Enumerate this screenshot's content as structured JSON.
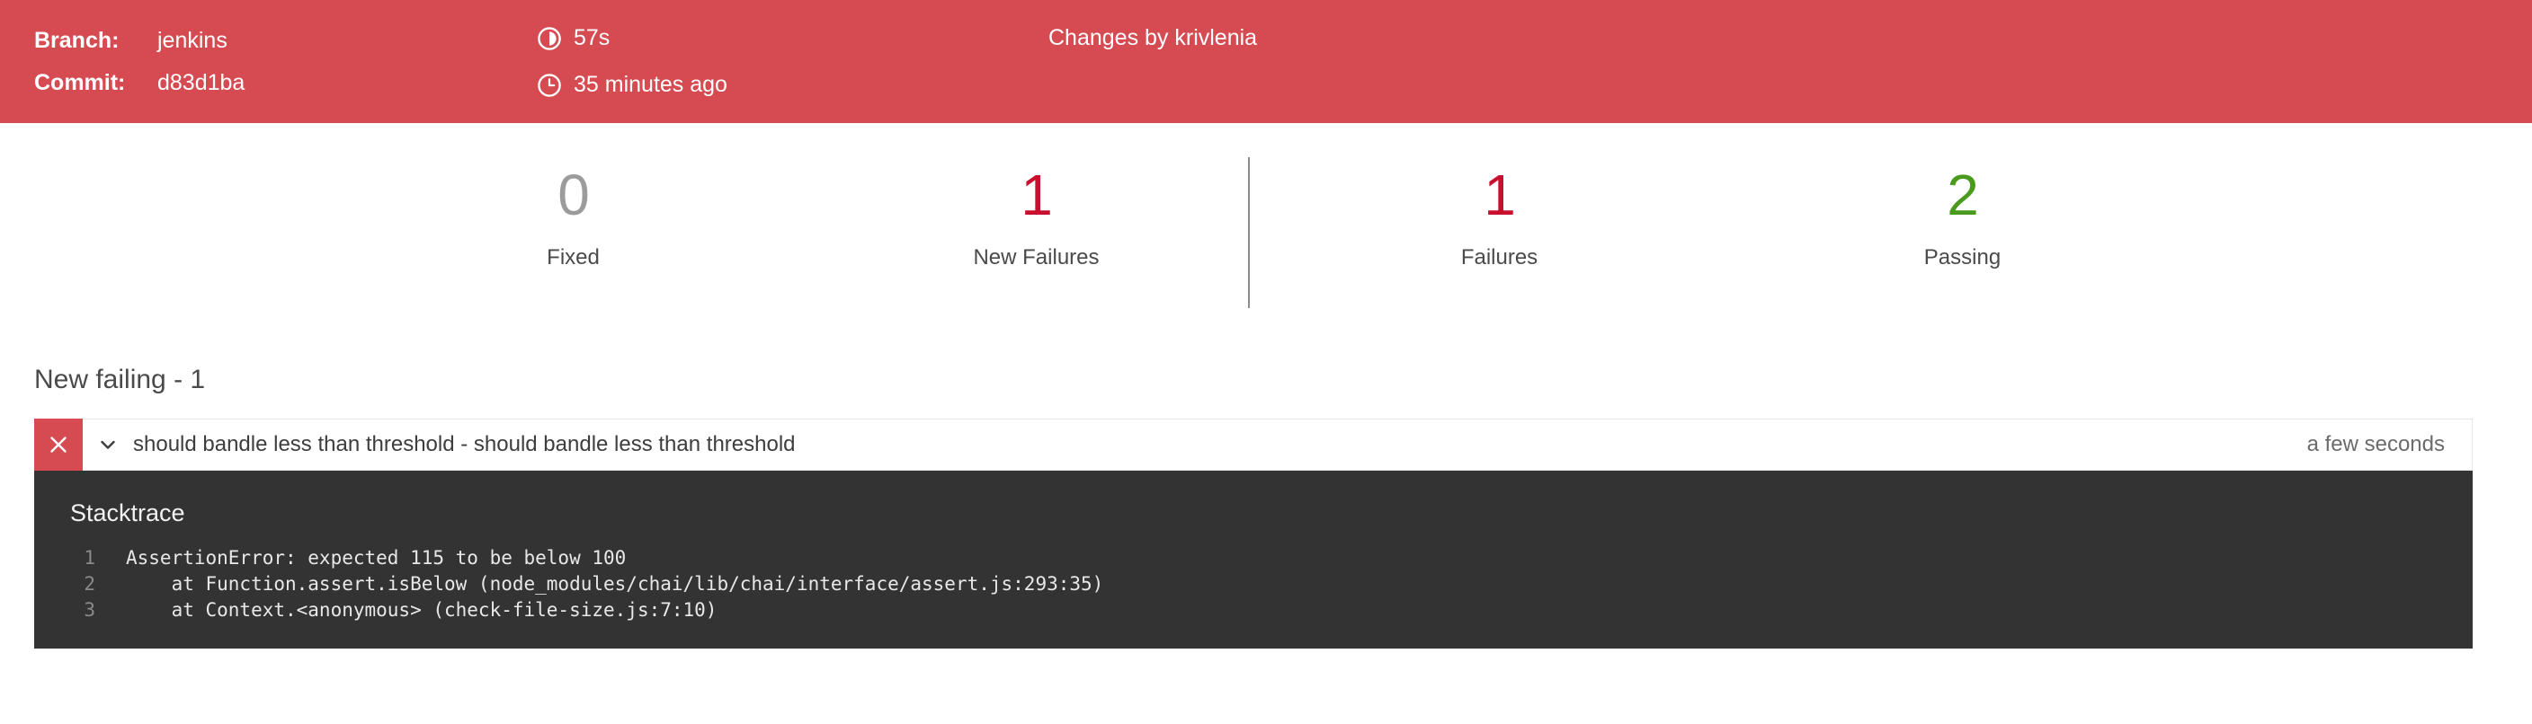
{
  "header": {
    "background_color": "#d54b51",
    "branch_label": "Branch:",
    "branch_value": "jenkins",
    "commit_label": "Commit:",
    "commit_value": "d83d1ba",
    "duration_icon": "duration-pie-icon",
    "duration_value": "57s",
    "time_icon": "clock-icon",
    "time_value": "35 minutes ago",
    "changes_by": "Changes by krivlenia"
  },
  "stats": {
    "items": [
      {
        "value": "0",
        "label": "Fixed",
        "color": "#9b9b9b",
        "tone": "grey"
      },
      {
        "value": "1",
        "label": "New Failures",
        "color": "#c8102e",
        "tone": "red"
      },
      {
        "value": "1",
        "label": "Failures",
        "color": "#c8102e",
        "tone": "red"
      },
      {
        "value": "2",
        "label": "Passing",
        "color": "#4a9a1e",
        "tone": "green"
      }
    ]
  },
  "section": {
    "heading": "New failing - 1"
  },
  "result": {
    "status_icon": "close-x-icon",
    "status_color": "#d54b51",
    "expander_icon": "chevron-down-icon",
    "title": "should bandle less than threshold - should bandle less than threshold",
    "duration": "a few seconds",
    "stacktrace_title": "Stacktrace",
    "stacktrace_lines": [
      {
        "n": "1",
        "text": "AssertionError: expected 115 to be below 100"
      },
      {
        "n": "2",
        "text": "    at Function.assert.isBelow (node_modules/chai/lib/chai/interface/assert.js:293:35)"
      },
      {
        "n": "3",
        "text": "    at Context.<anonymous> (check-file-size.js:7:10)"
      }
    ]
  }
}
